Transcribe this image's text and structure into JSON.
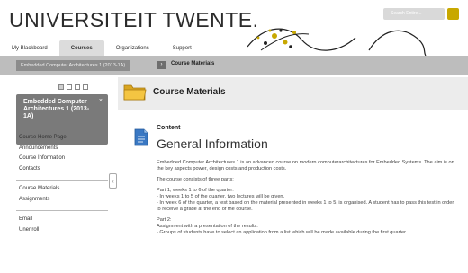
{
  "header": {
    "logo": "UNIVERSITEIT TWENTE.",
    "search_placeholder": "Search Entire..."
  },
  "nav": {
    "tabs": [
      "My Blackboard",
      "Courses",
      "Organizations",
      "Support"
    ],
    "active": "Courses"
  },
  "breadcrumb": {
    "course": "Embedded Computer Architectures 1 (2013-1A)",
    "page": "Course Materials"
  },
  "sidebar": {
    "course_title": "Embedded Computer Architectures 1 (2013-1A)",
    "menu_group_1": [
      "Course Home Page",
      "Announcements",
      "Course Information",
      "Contacts"
    ],
    "menu_group_2": [
      "Course Materials",
      "Assignments"
    ],
    "menu_group_3": [
      "Email",
      "Unenroll"
    ]
  },
  "main": {
    "title": "Course Materials",
    "content_label": "Content",
    "heading": "General Information",
    "paragraphs": [
      "Embedded Computer Architectures 1 is an advanced course on modern computerarchitectures for Embedded Systems. The aim is on the key aspects power, design costs and production costs.",
      "The course consists of three parts:",
      "Part 1, weeks 1 to 6 of the quarter:",
      "- In weeks 1 to 5 of the quarter, two lectures will be given.",
      "- In week 6 of the quarter, a test based on the material presented in weeks 1 to 5, is organised. A student has to pass this test in order to receive a grade at the end of the course.",
      "Part 2:",
      "Assignment with a presentation of the results.",
      "- Groups of students have to select an application from a list which will be made available during the first quarter."
    ]
  },
  "colors": {
    "accent_yellow": "#c8a800",
    "crumb_bar": "#bdbdbd",
    "course_box": "#7a7a7a"
  }
}
